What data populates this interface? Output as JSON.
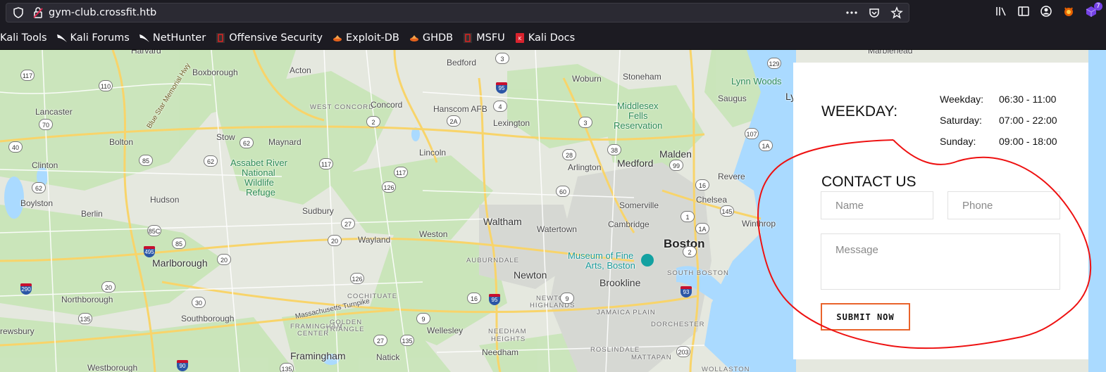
{
  "browser": {
    "url": "gym-club.crossfit.htb",
    "extension_badge": "7",
    "bookmarks": [
      {
        "label": "Kali Tools",
        "icon": "kali-icon"
      },
      {
        "label": "Kali Forums",
        "icon": "kali-dragon-icon"
      },
      {
        "label": "NetHunter",
        "icon": "kali-dragon-icon"
      },
      {
        "label": "Offensive Security",
        "icon": "offsec-icon"
      },
      {
        "label": "Exploit-DB",
        "icon": "exploitdb-icon"
      },
      {
        "label": "GHDB",
        "icon": "ghdb-icon"
      },
      {
        "label": "MSFU",
        "icon": "offsec-icon"
      },
      {
        "label": "Kali Docs",
        "icon": "kali-docs-icon"
      }
    ]
  },
  "map": {
    "places": [
      "Harvard",
      "Boxborough",
      "Acton",
      "Bedford",
      "Woburn",
      "Stoneham",
      "Marblehead",
      "Lynn Woods",
      "Lancaster",
      "WEST CONCORD",
      "Concord",
      "Hanscom AFB",
      "Lexington",
      "Saugus",
      "Middlesex",
      "Fells",
      "Reservation",
      "Bolton",
      "Stow",
      "Maynard",
      "Malden",
      "Clinton",
      "Assabet River",
      "National",
      "Wildlife",
      "Refuge",
      "Lincoln",
      "Arlington",
      "Medford",
      "Revere",
      "Hudson",
      "Boylston",
      "Berlin",
      "Sudbury",
      "Somerville",
      "Chelsea",
      "Cambridge",
      "Winthrop",
      "Waltham",
      "Watertown",
      "Weston",
      "Wayland",
      "Boston",
      "Museum of Fine",
      "Arts, Boston",
      "Marlborough",
      "AUBURNDALE",
      "Newton",
      "SOUTH BOSTON",
      "Brookline",
      "Northborough",
      "COCHITUATE",
      "NEWTON",
      "HIGHLANDS",
      "JAMAICA PLAIN",
      "Southborough",
      "Massachusetts Turnpike",
      "FRAMINGHAM",
      "CENTER",
      "GOLDEN",
      "TRIANGLE",
      "Wellesley",
      "DORCHESTER",
      "NEEDHAM",
      "HEIGHTS",
      "rewsbury",
      "Needham",
      "Framingham",
      "Natick",
      "ROSLINDALE",
      "MATTAPAN",
      "Westborough",
      "WOLLASTON",
      "Blue Star Memorial Hwy",
      "Ly"
    ],
    "route_shields": [
      "117",
      "110",
      "70",
      "40",
      "85",
      "62",
      "117",
      "2",
      "2A",
      "4",
      "3",
      "38",
      "95",
      "3",
      "62",
      "85C",
      "495",
      "85",
      "20",
      "117",
      "126",
      "60",
      "20",
      "27",
      "28",
      "1",
      "1A",
      "145",
      "99",
      "16",
      "129",
      "107",
      "1A",
      "290",
      "20",
      "30",
      "9",
      "16",
      "95",
      "135",
      "126",
      "135",
      "27",
      "9",
      "135",
      "90",
      "203",
      "93",
      "2",
      "62"
    ]
  },
  "card": {
    "weekday_title": "WEEKDAY:",
    "hours": [
      {
        "day": "Weekday:",
        "time": "06:30 - 11:00"
      },
      {
        "day": "Saturday:",
        "time": "07:00 - 22:00"
      },
      {
        "day": "Sunday:",
        "time": "09:00 - 18:00"
      }
    ],
    "contact_title": "CONTACT US",
    "name_placeholder": "Name",
    "phone_placeholder": "Phone",
    "message_placeholder": "Message",
    "submit_label": "SUBMIT NOW"
  },
  "colors": {
    "accent": "#e9632b",
    "annotation": "#ee1111",
    "water": "#aadaff",
    "park": "#c4e3b5"
  }
}
